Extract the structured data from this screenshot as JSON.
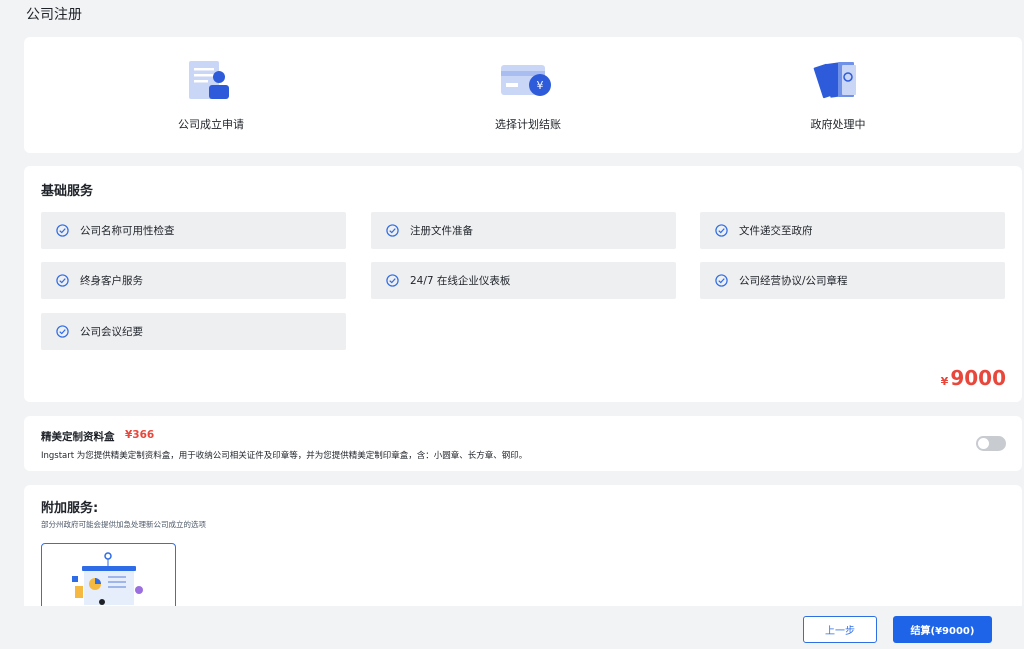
{
  "page_title": "公司注册",
  "steps": [
    {
      "label": "公司成立申请",
      "icon": "application-form-icon"
    },
    {
      "label": "选择计划结账",
      "icon": "payment-card-icon"
    },
    {
      "label": "政府处理中",
      "icon": "documents-processing-icon"
    }
  ],
  "basic": {
    "title": "基础服务",
    "items": [
      "公司名称可用性检查",
      "注册文件准备",
      "文件递交至政府",
      "终身客户服务",
      "24/7 在线企业仪表板",
      "公司经营协议/公司章程",
      "公司会议纪要"
    ],
    "price_symbol": "¥",
    "price_value": "9000"
  },
  "box_addon": {
    "title": "精美定制资料盒",
    "price": "¥366",
    "description": "Ingstart 为您提供精美定制资料盒，用于收纳公司相关证件及印章等，并为您提供精美定制印章盒，含：小圆章、长方章、钢印。",
    "enabled": false
  },
  "additional": {
    "title": "附加服务:",
    "subtitle": "部分州政府可能会提供加急处理新公司成立的选项"
  },
  "footer": {
    "prev_label": "上一步",
    "pay_label": "结算(¥9000)"
  },
  "colors": {
    "accent": "#1d64e8",
    "price": "#e8473b",
    "background": "#f2f3f5"
  }
}
